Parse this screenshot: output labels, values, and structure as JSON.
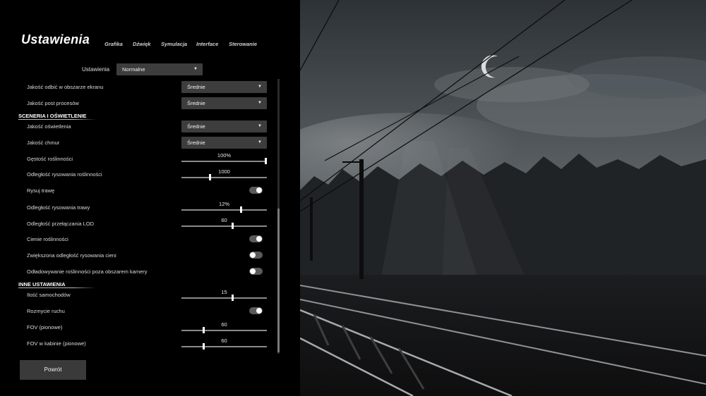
{
  "header": {
    "title": "Ustawienia",
    "tabs": [
      "Grafika",
      "Dźwięk",
      "Symulacja",
      "Interface",
      "Sterowanie"
    ]
  },
  "preset": {
    "label": "Ustawienia",
    "value": "Normalne"
  },
  "rows": {
    "reflections": {
      "label": "Jakość odbić w obszarze ekranu",
      "value": "Średnie"
    },
    "postprocess": {
      "label": "Jakość post procesów",
      "value": "Średnie"
    },
    "section_scenery": "SCENERIA I OŚWIETLENIE",
    "lighting": {
      "label": "Jakość oświetlenia",
      "value": "Średnie"
    },
    "clouds": {
      "label": "Jakość chmur",
      "value": "Średnie"
    },
    "vegetation_density": {
      "label": "Gęstość roślinności",
      "value_text": "100%",
      "level": 1.0
    },
    "vegetation_distance": {
      "label": "Odległość rysowania roślinności",
      "value_text": "1000",
      "level": 0.33
    },
    "draw_grass": {
      "label": "Rysuj trawę",
      "on": true
    },
    "grass_distance": {
      "label": "Odległość rysowania trawy",
      "value_text": "12%",
      "level": 0.7
    },
    "lod_distance": {
      "label": "Odległość przełączania LOD",
      "value_text": "60",
      "level": 0.6
    },
    "vegetation_shadows": {
      "label": "Cienie roślinności",
      "on": true
    },
    "shadow_distance": {
      "label": "Zwiększona odległość rysowania cieni",
      "on": false
    },
    "offscreen_vegetation": {
      "label": "Odładowywanie roślinności poza obszarem kamery",
      "on": false
    },
    "section_other": "INNE USTAWIENIA",
    "cars": {
      "label": "Ilość samochodów",
      "value_text": "15",
      "level": 0.6
    },
    "motion_blur": {
      "label": "Rozmycie ruchu",
      "on": true
    },
    "fov": {
      "label": "FOV (pionowe)",
      "value_text": "60",
      "level": 0.25
    },
    "fov_cabin": {
      "label": "FOV w kabinie (pionowe)",
      "value_text": "60",
      "level": 0.25
    }
  },
  "footer": {
    "back_label": "Powrót"
  },
  "icons": {
    "dropdown": "chevron-down-icon"
  },
  "colors": {
    "panel": "#000000",
    "control": "#3d3d3d",
    "accent": "#ffffff"
  }
}
